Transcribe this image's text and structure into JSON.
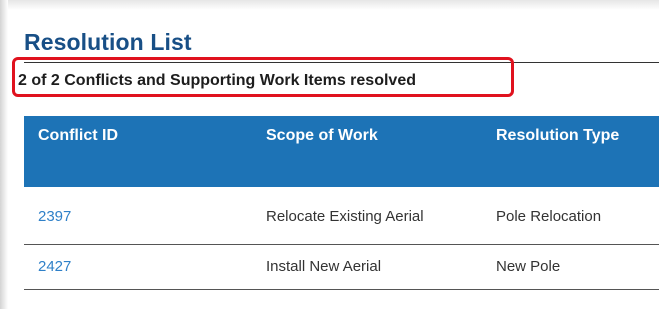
{
  "section": {
    "title": "Resolution List",
    "summary": "2 of 2 Conflicts and Supporting Work Items resolved"
  },
  "table": {
    "columns": [
      "Conflict ID",
      "Scope of Work",
      "Resolution Type"
    ],
    "rows": [
      {
        "conflict_id": "2397",
        "scope": "Relocate Existing Aerial",
        "resolution": "Pole Relocation"
      },
      {
        "conflict_id": "2427",
        "scope": "Install New Aerial",
        "resolution": "New Pole"
      }
    ]
  },
  "colors": {
    "title": "#184f86",
    "header_bg": "#1d73b6",
    "link": "#2f80c8",
    "highlight_border": "#e0121e"
  }
}
